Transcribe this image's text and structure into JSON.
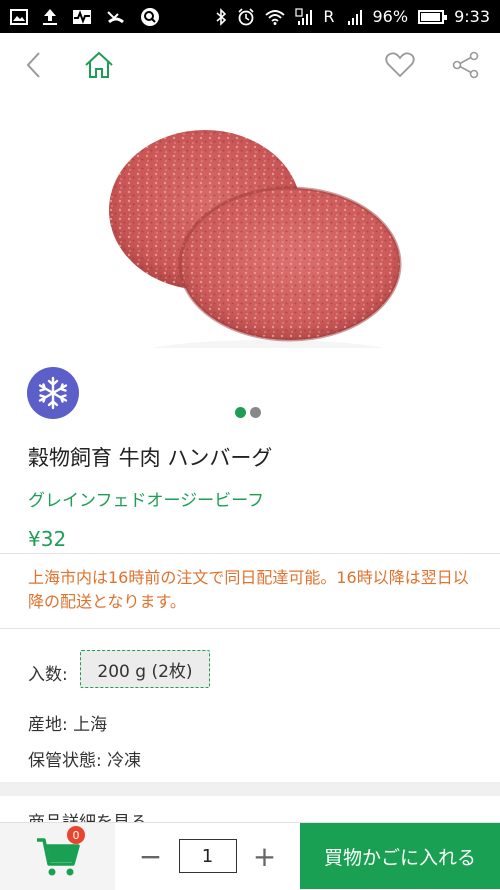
{
  "status_bar": {
    "battery": "96%",
    "time": "9:33",
    "network_label": "R",
    "battery_level": 0.96
  },
  "header": {
    "back_icon": "chevron-left-icon",
    "home_icon": "home-icon",
    "favorite_icon": "heart-icon",
    "share_icon": "share-icon"
  },
  "product": {
    "title": "穀物飼育 牛肉 ハンバーグ",
    "subtitle": "グレインフェドオージービーフ",
    "price": "¥32",
    "notice": "上海市内は16時前の注文で同日配達可能。16時以降は翌日以降の配送となります。",
    "badge_icon": "snowflake-icon",
    "image_slides": 2,
    "active_slide": 1,
    "quantity_label": "入数:",
    "quantity_option": "200 g (2枚)",
    "origin": "産地: 上海",
    "storage": "保管状態: 冷凍",
    "details_link": "商品詳細を見る"
  },
  "bottom_bar": {
    "cart_count": "0",
    "quantity": "1",
    "minus": "−",
    "plus": "+",
    "add_to_cart": "買物かごに入れる"
  },
  "colors": {
    "accent": "#1e9e55",
    "notice": "#e0722e",
    "badge": "#5b5fc7",
    "cart_badge": "#e8442e"
  }
}
